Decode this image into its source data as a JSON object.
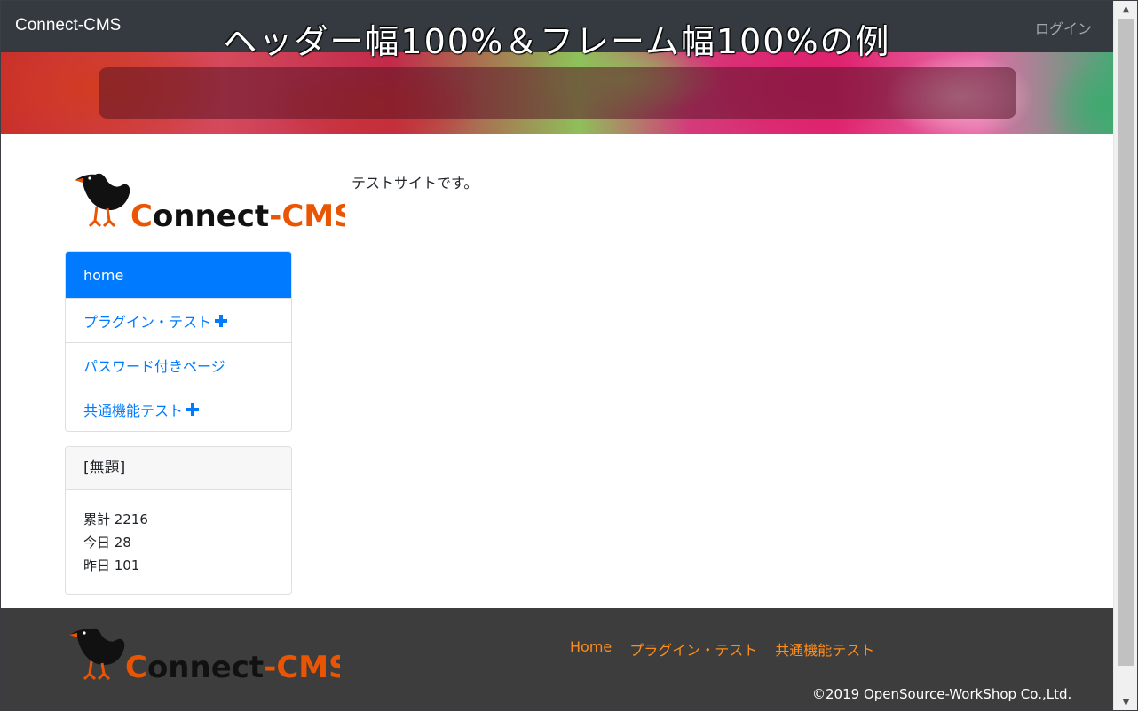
{
  "navbar": {
    "brand": "Connect-CMS",
    "login_label": "ログイン"
  },
  "banner": {
    "title": "ヘッダー幅100%＆フレーム幅100%の例"
  },
  "logo": {
    "text_connect": "Connect",
    "text_dash": "-",
    "text_cms": "CMS"
  },
  "menu": {
    "items": [
      {
        "label": "home",
        "active": true,
        "has_children": false
      },
      {
        "label": "プラグイン・テスト",
        "active": false,
        "has_children": true
      },
      {
        "label": "パスワード付きページ",
        "active": false,
        "has_children": false
      },
      {
        "label": "共通機能テスト",
        "active": false,
        "has_children": true
      }
    ]
  },
  "counter": {
    "title": "[無題]",
    "total": "累計 2216",
    "today": "今日 28",
    "yesterday": "昨日 101"
  },
  "content": {
    "text": "テストサイトです。"
  },
  "footer": {
    "links": [
      "Home",
      "プラグイン・テスト",
      "共通機能テスト"
    ],
    "copyright": "©2019 OpenSource-WorkShop Co.,Ltd."
  },
  "colors": {
    "navbar_bg": "#343a40",
    "accent": "#007bff",
    "footer_bg": "#3d3d3d",
    "footer_link": "#ff8c1a",
    "logo_orange": "#ea5504"
  },
  "icons": [
    "plus-icon",
    "bird-logo-icon",
    "scroll-up-arrow-icon",
    "scroll-down-arrow-icon"
  ]
}
